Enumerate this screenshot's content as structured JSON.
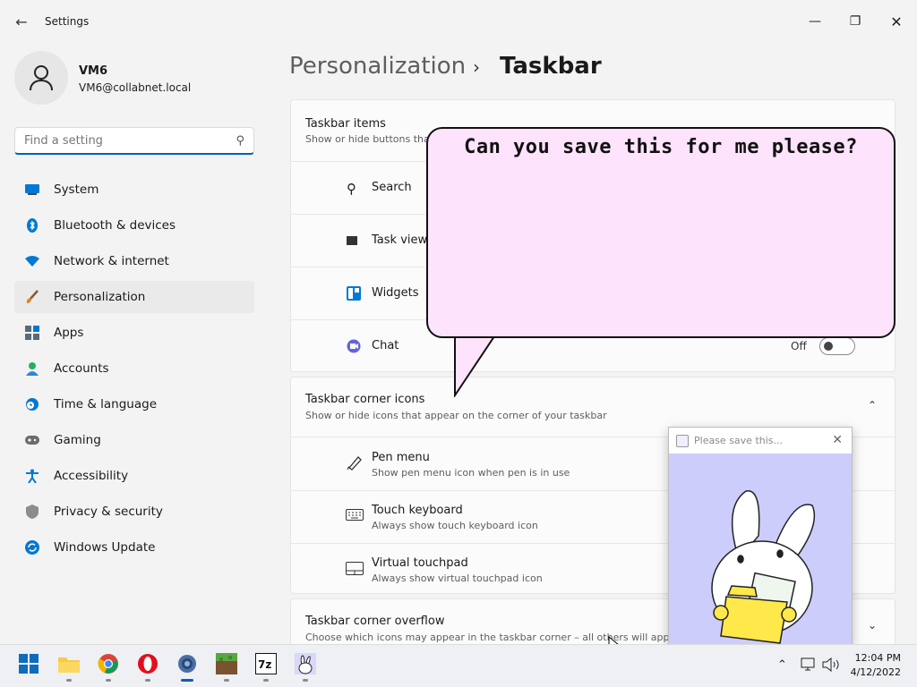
{
  "window": {
    "title": "Settings"
  },
  "user": {
    "name": "VM6",
    "email": "VM6@collabnet.local"
  },
  "search": {
    "placeholder": "Find a setting"
  },
  "nav": [
    {
      "label": "System",
      "icon": "monitor-icon",
      "color": "#0078d4"
    },
    {
      "label": "Bluetooth & devices",
      "icon": "bluetooth-icon",
      "color": "#0078d4"
    },
    {
      "label": "Network & internet",
      "icon": "wifi-icon",
      "color": "#0078d4"
    },
    {
      "label": "Personalization",
      "icon": "paintbrush-icon",
      "color": "#e67e22",
      "active": true
    },
    {
      "label": "Apps",
      "icon": "apps-icon",
      "color": "#555"
    },
    {
      "label": "Accounts",
      "icon": "person-icon",
      "color": "#27ae60"
    },
    {
      "label": "Time & language",
      "icon": "globe-clock-icon",
      "color": "#0078d4"
    },
    {
      "label": "Gaming",
      "icon": "gamepad-icon",
      "color": "#666"
    },
    {
      "label": "Accessibility",
      "icon": "accessibility-icon",
      "color": "#0078d4"
    },
    {
      "label": "Privacy & security",
      "icon": "shield-icon",
      "color": "#888"
    },
    {
      "label": "Windows Update",
      "icon": "update-icon",
      "color": "#0078d4"
    }
  ],
  "breadcrumb": {
    "parent": "Personalization",
    "separator": "›",
    "current": "Taskbar"
  },
  "taskbar_items": {
    "title": "Taskbar items",
    "subtitle": "Show or hide buttons tha",
    "rows": [
      {
        "label": "Search",
        "icon": "search-icon"
      },
      {
        "label": "Task view",
        "icon": "task-view-icon"
      },
      {
        "label": "Widgets",
        "icon": "widgets-icon"
      },
      {
        "label": "Chat",
        "icon": "chat-icon",
        "state": "Off"
      }
    ]
  },
  "corner_icons": {
    "title": "Taskbar corner icons",
    "subtitle": "Show or hide icons that appear on the corner of your taskbar",
    "rows": [
      {
        "label": "Pen menu",
        "sub": "Show pen menu icon when pen is in use",
        "icon": "pen-icon"
      },
      {
        "label": "Touch keyboard",
        "sub": "Always show touch keyboard icon",
        "icon": "keyboard-icon"
      },
      {
        "label": "Virtual touchpad",
        "sub": "Always show virtual touchpad icon",
        "icon": "touchpad-icon"
      }
    ]
  },
  "corner_overflow": {
    "title": "Taskbar corner overflow",
    "subtitle": "Choose which icons may appear in the taskbar corner – all others will appea"
  },
  "bubble": {
    "text": "Can you save this for me please?"
  },
  "popup": {
    "title": "Please save this..."
  },
  "taskbar": {
    "apps": [
      "start-icon",
      "file-explorer-icon",
      "chrome-icon",
      "opera-icon",
      "settings-icon",
      "minecraft-icon",
      "7zip-icon",
      "bunny-app-icon"
    ],
    "time": "12:04 PM",
    "date": "4/12/2022"
  },
  "colors": {
    "accent": "#005fb8",
    "bubble": "#fde3fb",
    "popup_bg": "#cccdfb"
  }
}
